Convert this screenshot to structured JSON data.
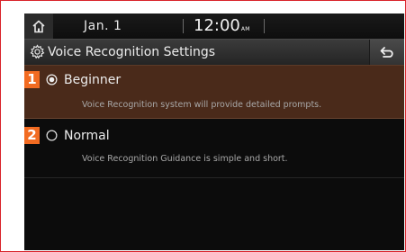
{
  "status_bar": {
    "home_icon": "home-icon",
    "date": "Jan.  1",
    "time": "12:00",
    "ampm": "AM"
  },
  "title_bar": {
    "settings_icon": "gear-icon",
    "title": "Voice Recognition Settings",
    "back_icon": "back-arrow-icon"
  },
  "options": [
    {
      "number": "1",
      "label": "Beginner",
      "description": "Voice Recognition system will provide detailed prompts.",
      "selected": true
    },
    {
      "number": "2",
      "label": "Normal",
      "description": "Voice Recognition Guidance is simple and short.",
      "selected": false
    }
  ],
  "colors": {
    "frame_border": "#d9232a",
    "number_badge": "#f26b21",
    "selected_row": "#4a2a1a",
    "screen_bg": "#0c0c0c"
  }
}
